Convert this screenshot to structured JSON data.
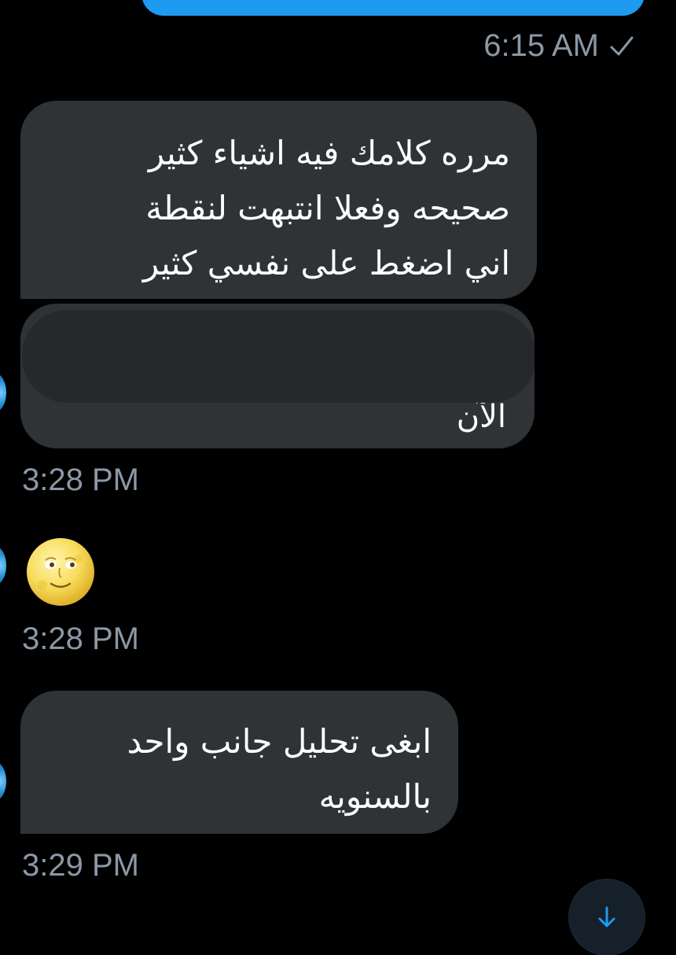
{
  "colors": {
    "background": "#000000",
    "sent_bubble": "#1d9bf0",
    "received_bubble": "#2f3336",
    "timestamp": "#8b98a5",
    "accent": "#1d9bf0"
  },
  "conversation": {
    "sent_timestamp": "6:15 AM",
    "sent_status_icon": "check-icon",
    "messages": [
      {
        "lines": [
          "مرره كلامك فيه اشياء كثير",
          "صحيحه وفعلا انتبهت لنقطة",
          "اني اضغط على نفسي كثير"
        ]
      },
      {
        "redacted": true,
        "visible_tail": "الآن",
        "timestamp": "3:28 PM"
      },
      {
        "emoji": "full-moon-face-emoji",
        "timestamp": "3:28 PM"
      },
      {
        "lines": [
          "ابغى تحليل جانب واحد",
          "بالسنويه"
        ],
        "timestamp": "3:29 PM"
      }
    ]
  },
  "controls": {
    "scroll_down_icon": "arrow-down-icon"
  }
}
